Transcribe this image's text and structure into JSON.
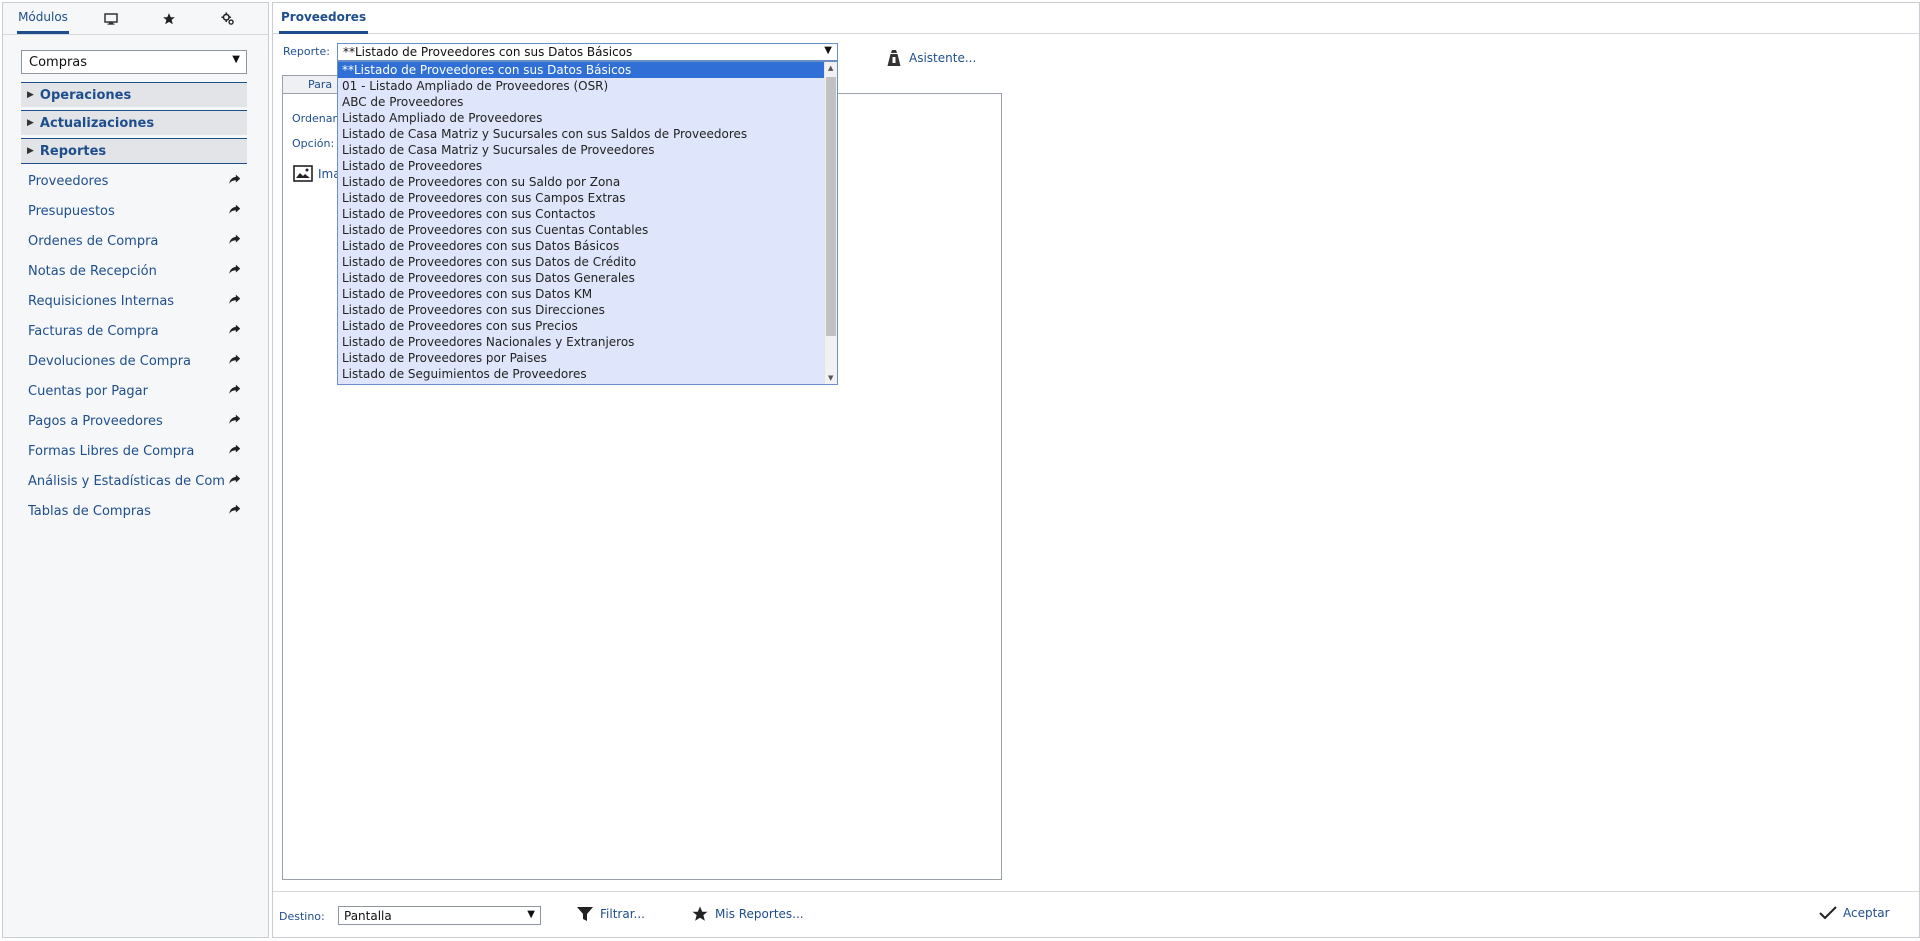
{
  "left_tabs": [
    {
      "label": "Módulos",
      "icon": "modules"
    },
    {
      "label": "",
      "icon": "monitor-icon"
    },
    {
      "label": "",
      "icon": "star-icon"
    },
    {
      "label": "",
      "icon": "gears-icon"
    }
  ],
  "module_select": {
    "value": "Compras"
  },
  "sections": [
    {
      "label": "Operaciones"
    },
    {
      "label": "Actualizaciones"
    },
    {
      "label": "Reportes"
    }
  ],
  "nav_items": [
    {
      "label": "Proveedores"
    },
    {
      "label": "Presupuestos"
    },
    {
      "label": "Órdenes de Compra"
    },
    {
      "label": "Notas de Recepción"
    },
    {
      "label": "Requisiciones Internas"
    },
    {
      "label": "Facturas de Compra"
    },
    {
      "label": "Devoluciones de Compra"
    },
    {
      "label": "Cuentas por Pagar"
    },
    {
      "label": "Pagos a Proveedores"
    },
    {
      "label": "Formas Libres de Compra"
    },
    {
      "label": "Análisis y Estadísticas de Com"
    },
    {
      "label": "Tablas de Compras"
    }
  ],
  "main_tab": {
    "label": "Proveedores"
  },
  "report": {
    "label": "Reporte:",
    "value": "**Listado de Proveedores con sus Datos Básicos",
    "options": [
      "**Listado de Proveedores con sus Datos Básicos",
      "01 - Listado Ampliado de Proveedores (OSR)",
      "ABC de Proveedores",
      "Listado Ampliado de Proveedores",
      "Listado de Casa Matriz y Sucursales con sus Saldos de Proveedores",
      "Listado de Casa Matriz y Sucursales de Proveedores",
      "Listado de Proveedores",
      "Listado de Proveedores con su Saldo por Zona",
      "Listado de Proveedores con sus Campos Extras",
      "Listado de Proveedores con sus Contactos",
      "Listado de Proveedores con sus Cuentas Contables",
      "Listado de Proveedores con sus Datos Básicos",
      "Listado de Proveedores con sus Datos de Crédito",
      "Listado de Proveedores con sus Datos Generales",
      "Listado de Proveedores con sus Datos KM",
      "Listado de Proveedores con sus Direcciones",
      "Listado de Proveedores con sus Precios",
      "Listado de Proveedores Nacionales y Extranjeros",
      "Listado de Proveedores por Paises",
      "Listado de Seguimientos de Proveedores"
    ]
  },
  "wizard": {
    "label": "Asistente..."
  },
  "params_tab": {
    "label": "Para"
  },
  "params": {
    "order_label": "Ordenar",
    "option_label": "Opción:",
    "image_label": "Ima"
  },
  "footer": {
    "destino_label": "Destino:",
    "destino_value": "Pantalla",
    "filter_label": "Filtrar...",
    "my_reports_label": "Mis Reportes...",
    "accept_label": "Aceptar"
  }
}
